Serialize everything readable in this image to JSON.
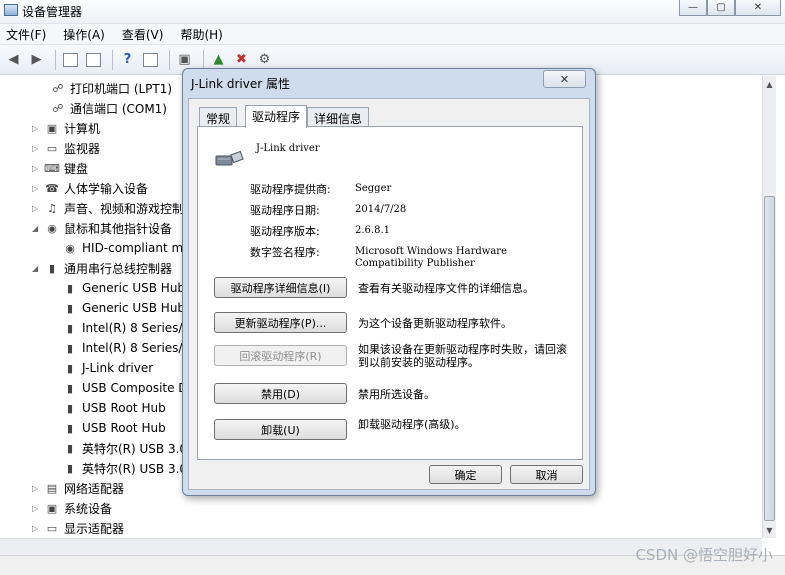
{
  "window": {
    "title": "设备管理器",
    "controls": [
      "—",
      "▢",
      "✕"
    ]
  },
  "menubar": {
    "items": [
      "文件(F)",
      "操作(A)",
      "查看(V)",
      "帮助(H)"
    ]
  },
  "toolbar": {
    "icons": [
      "back-arrow-icon",
      "forward-arrow-icon",
      "properties-view-icon",
      "device-list-icon",
      "help-icon",
      "scan-hardware-icon",
      "update-driver-icon",
      "disable-device-icon",
      "uninstall-device-icon"
    ]
  },
  "tree": {
    "items": [
      {
        "label": "打印机端口 (LPT1)",
        "icon": "port-icon"
      },
      {
        "label": "通信端口 (COM1)",
        "icon": "port-icon"
      },
      {
        "label": "计算机",
        "icon": "computer-icon"
      },
      {
        "label": "监视器",
        "icon": "monitor-icon"
      },
      {
        "label": "键盘",
        "icon": "keyboard-icon"
      },
      {
        "label": "人体学输入设备",
        "icon": "hid-icon"
      },
      {
        "label": "声音、视频和游戏控制",
        "icon": "sound-icon"
      },
      {
        "label": "鼠标和其他指针设备",
        "icon": "mouse-icon"
      },
      {
        "label": "HID-compliant m",
        "icon": "mouse-icon"
      },
      {
        "label": "通用串行总线控制器",
        "icon": "usb-icon"
      },
      {
        "label": "Generic USB Hub",
        "icon": "usb-icon"
      },
      {
        "label": "Generic USB Hub",
        "icon": "usb-icon"
      },
      {
        "label": "Intel(R) 8 Series/(",
        "icon": "usb-icon"
      },
      {
        "label": "Intel(R) 8 Series/(",
        "icon": "usb-icon"
      },
      {
        "label": "J-Link driver",
        "icon": "usb-icon"
      },
      {
        "label": "USB Composite D",
        "icon": "usb-icon"
      },
      {
        "label": "USB Root Hub",
        "icon": "usb-icon"
      },
      {
        "label": "USB Root Hub",
        "icon": "usb-icon"
      },
      {
        "label": "英特尔(R) USB 3.0",
        "icon": "usb-icon"
      },
      {
        "label": "英特尔(R) USB 3.0",
        "icon": "usb-icon"
      },
      {
        "label": "网络适配器",
        "icon": "network-icon"
      },
      {
        "label": "系统设备",
        "icon": "system-icon"
      },
      {
        "label": "显示适配器",
        "icon": "display-icon"
      }
    ]
  },
  "dialog": {
    "title": "J-Link driver 属性",
    "close": "✕",
    "tabs": [
      "常规",
      "驱动程序",
      "详细信息"
    ],
    "active_tab": "驱动程序",
    "driver_name": "J-Link driver",
    "properties": [
      {
        "label": "驱动程序提供商:",
        "value": "Segger"
      },
      {
        "label": "驱动程序日期:",
        "value": "2014/7/28"
      },
      {
        "label": "驱动程序版本:",
        "value": "2.6.8.1"
      },
      {
        "label": "数字签名程序:",
        "value": "Microsoft Windows Hardware Compatibility Publisher"
      }
    ],
    "actions": [
      {
        "button": "驱动程序详细信息(I)",
        "desc": "查看有关驱动程序文件的详细信息。",
        "enabled": true
      },
      {
        "button": "更新驱动程序(P)...",
        "desc": "为这个设备更新驱动程序软件。",
        "enabled": true
      },
      {
        "button": "回滚驱动程序(R)",
        "desc": "如果该设备在更新驱动程序时失败，请回滚到以前安装的驱动程序。",
        "enabled": false
      },
      {
        "button": "禁用(D)",
        "desc": "禁用所选设备。",
        "enabled": true
      },
      {
        "button": "卸载(U)",
        "desc": "卸载驱动程序(高级)。",
        "enabled": true
      }
    ],
    "ok": "确定",
    "cancel": "取消"
  },
  "watermark": "CSDN @悟空胆好小"
}
